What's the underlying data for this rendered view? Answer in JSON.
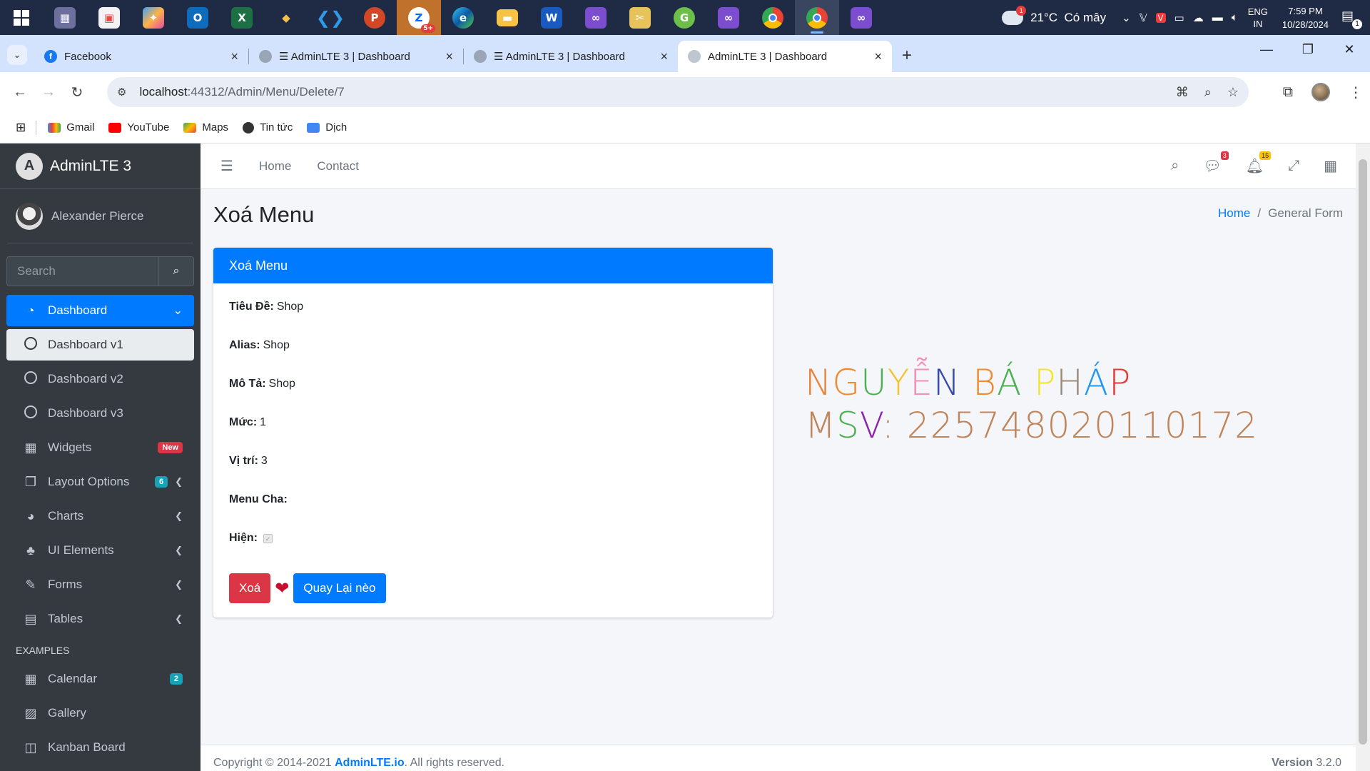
{
  "taskbar": {
    "weather": {
      "temp": "21°C",
      "condition": "Có mây",
      "badge": "1"
    },
    "language": {
      "line1": "ENG",
      "line2": "IN"
    },
    "clock": {
      "time": "7:59 PM",
      "date": "10/28/2024"
    },
    "notification_count": "1",
    "zalo_badge": "5+"
  },
  "browser": {
    "tabs": [
      {
        "label": "Facebook",
        "active": false
      },
      {
        "label": "☰ AdminLTE 3 | Dashboard",
        "active": false
      },
      {
        "label": "☰ AdminLTE 3 | Dashboard",
        "active": false
      },
      {
        "label": "AdminLTE 3 | Dashboard",
        "active": true
      }
    ],
    "url_host": "localhost",
    "url_path": ":44312/Admin/Menu/Delete/7",
    "bookmarks": [
      "Gmail",
      "YouTube",
      "Maps",
      "Tin tức",
      "Dịch"
    ]
  },
  "sidebar": {
    "brand": "AdminLTE 3",
    "brand_logo": "A",
    "user": "Alexander Pierce",
    "search_placeholder": "Search",
    "items": [
      {
        "label": "Dashboard",
        "icon": "tachometer-icon"
      },
      {
        "label": "Dashboard v1",
        "icon": "circle-icon"
      },
      {
        "label": "Dashboard v2",
        "icon": "circle-icon"
      },
      {
        "label": "Dashboard v3",
        "icon": "circle-icon"
      },
      {
        "label": "Widgets",
        "icon": "th-icon",
        "badge": "New"
      },
      {
        "label": "Layout Options",
        "icon": "copy-icon",
        "badge": "6"
      },
      {
        "label": "Charts",
        "icon": "pie-chart-icon"
      },
      {
        "label": "UI Elements",
        "icon": "tree-icon"
      },
      {
        "label": "Forms",
        "icon": "edit-icon"
      },
      {
        "label": "Tables",
        "icon": "table-icon"
      },
      {
        "label": "Calendar",
        "icon": "calendar-icon",
        "badge": "2"
      },
      {
        "label": "Gallery",
        "icon": "image-icon"
      },
      {
        "label": "Kanban Board",
        "icon": "columns-icon"
      }
    ],
    "header_examples": "EXAMPLES"
  },
  "navbar": {
    "home": "Home",
    "contact": "Contact",
    "messages_badge": "3",
    "notifications_badge": "15"
  },
  "content": {
    "title": "Xoá Menu",
    "breadcrumb_home": "Home",
    "breadcrumb_current": "General Form",
    "card_title": "Xoá Menu",
    "fields": [
      {
        "label": "Tiêu Đề:",
        "value": "Shop"
      },
      {
        "label": "Alias:",
        "value": "Shop"
      },
      {
        "label": "Mô Tả:",
        "value": "Shop"
      },
      {
        "label": "Mức:",
        "value": "1"
      },
      {
        "label": "Vị trí:",
        "value": "3"
      },
      {
        "label": "Menu Cha:",
        "value": ""
      },
      {
        "label": "Hiện:",
        "value": ""
      }
    ],
    "delete_button": "Xoá",
    "back_button": "Quay Lại nèo"
  },
  "student": {
    "name_letters": [
      {
        "ch": "N",
        "color": "#e8843c"
      },
      {
        "ch": "G",
        "color": "#f08a2c"
      },
      {
        "ch": "U",
        "color": "#4caf50"
      },
      {
        "ch": "Y",
        "color": "#f2c12e"
      },
      {
        "ch": "Ễ",
        "color": "#f48fb1"
      },
      {
        "ch": "N",
        "color": "#3949ab"
      },
      {
        "ch": " ",
        "color": "#000000"
      },
      {
        "ch": "B",
        "color": "#f08a2c"
      },
      {
        "ch": "Á",
        "color": "#4caf50"
      },
      {
        "ch": " ",
        "color": "#000000"
      },
      {
        "ch": "P",
        "color": "#f2e52e"
      },
      {
        "ch": "H",
        "color": "#9e8c7a"
      },
      {
        "ch": "Á",
        "color": "#2196f3"
      },
      {
        "ch": "P",
        "color": "#e53935"
      }
    ],
    "msv_letters": [
      {
        "ch": "M",
        "color": "#c0845a"
      },
      {
        "ch": "S",
        "color": "#4caf50"
      },
      {
        "ch": "V",
        "color": "#8e24aa"
      },
      {
        "ch": ":",
        "color": "#c0845a"
      }
    ],
    "msv_value": "225748020110172"
  },
  "footer": {
    "copyright_prefix": "Copyright © 2014-2021 ",
    "link": "AdminLTE.io",
    "suffix": ". All rights reserved.",
    "version_label": "Version",
    "version": "3.2.0"
  }
}
